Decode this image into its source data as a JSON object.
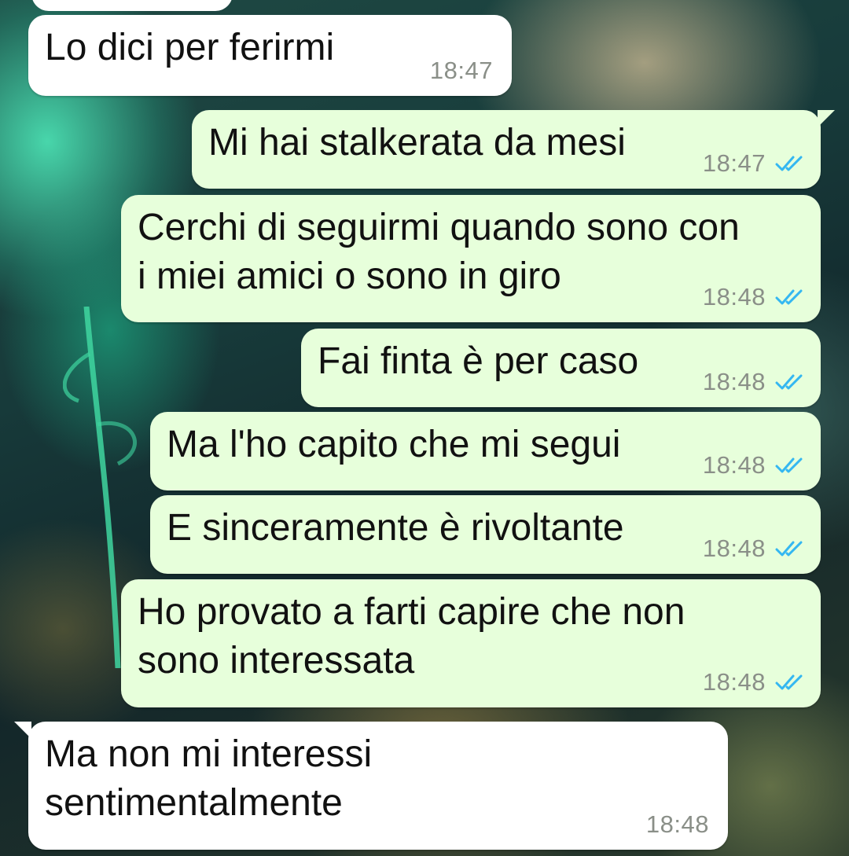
{
  "chat": {
    "messages": [
      {
        "direction": "incoming",
        "text": "Lo dici per ferirmi",
        "time": "18:47"
      },
      {
        "direction": "outgoing",
        "text": "Mi hai stalkerata da mesi",
        "time": "18:47",
        "status": "read",
        "status_icon": "double-check-icon"
      },
      {
        "direction": "outgoing",
        "text": "Cerchi di seguirmi quando sono con\ni miei amici o sono in giro",
        "time": "18:48",
        "status": "read",
        "status_icon": "double-check-icon"
      },
      {
        "direction": "outgoing",
        "text": "Fai finta è per caso",
        "time": "18:48",
        "status": "read",
        "status_icon": "double-check-icon"
      },
      {
        "direction": "outgoing",
        "text": "Ma l'ho capito che mi segui",
        "time": "18:48",
        "status": "read",
        "status_icon": "double-check-icon"
      },
      {
        "direction": "outgoing",
        "text": "E sinceramente è rivoltante",
        "time": "18:48",
        "status": "read",
        "status_icon": "double-check-icon"
      },
      {
        "direction": "outgoing",
        "text": "Ho provato a farti capire che non\nsono interessata",
        "time": "18:48",
        "status": "read",
        "status_icon": "double-check-icon"
      },
      {
        "direction": "incoming",
        "text": "Ma non mi interessi\nsentimentalmente",
        "time": "18:48"
      }
    ]
  },
  "colors": {
    "incoming_bubble": "#ffffff",
    "outgoing_bubble": "#e7ffdb",
    "timestamp": "#8a8f88",
    "read_ticks": "#34b7f1"
  }
}
